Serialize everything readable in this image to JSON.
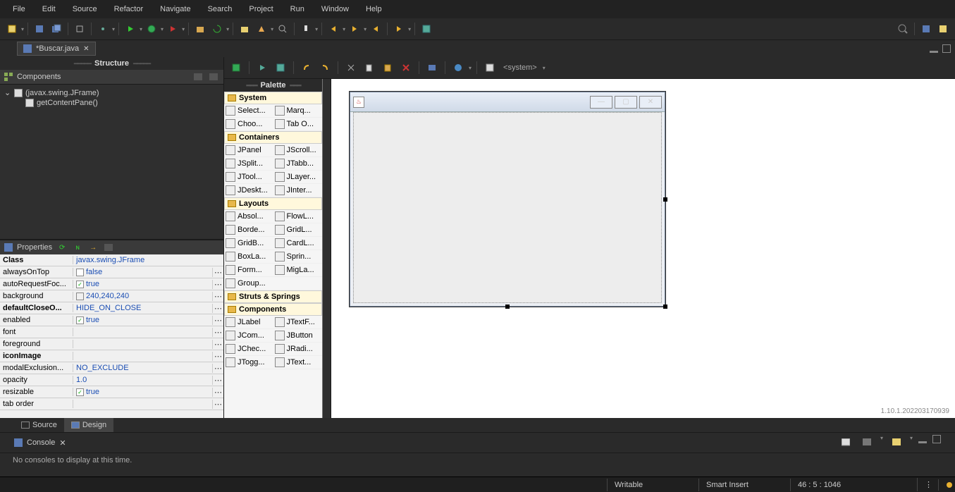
{
  "menu": [
    "File",
    "Edit",
    "Source",
    "Refactor",
    "Navigate",
    "Search",
    "Project",
    "Run",
    "Window",
    "Help"
  ],
  "file_tab": {
    "label": "*Buscar.java"
  },
  "structure": {
    "panel_label": "Structure",
    "header": "Components",
    "root": "(javax.swing.JFrame)",
    "child": "getContentPane()"
  },
  "properties": {
    "panel_label": "Properties",
    "rows": [
      {
        "k": "Class",
        "v": "javax.swing.JFrame",
        "bold": true,
        "dots": false
      },
      {
        "k": "alwaysOnTop",
        "v": "false",
        "chk": true,
        "checked": false,
        "dots": true
      },
      {
        "k": "autoRequestFoc...",
        "v": "true",
        "chk": true,
        "checked": true,
        "dots": true
      },
      {
        "k": "background",
        "v": "240,240,240",
        "swatch": "#f0f0f0",
        "dots": true
      },
      {
        "k": "defaultCloseO...",
        "v": "HIDE_ON_CLOSE",
        "bold": true,
        "dots": true
      },
      {
        "k": "enabled",
        "v": "true",
        "chk": true,
        "checked": true,
        "dots": true
      },
      {
        "k": "font",
        "v": "",
        "dots": true
      },
      {
        "k": "foreground",
        "v": "",
        "dots": true
      },
      {
        "k": "iconImage",
        "v": "",
        "bold": true,
        "dots": true
      },
      {
        "k": "modalExclusion...",
        "v": "NO_EXCLUDE",
        "dots": true
      },
      {
        "k": "opacity",
        "v": "1.0",
        "dots": true
      },
      {
        "k": "resizable",
        "v": "true",
        "chk": true,
        "checked": true,
        "dots": true
      },
      {
        "k": "tab order",
        "v": "",
        "dots": true
      }
    ]
  },
  "palette": {
    "panel_label": "Palette",
    "groups": [
      {
        "name": "System",
        "items": [
          [
            "Select...",
            "arrow"
          ],
          [
            "Marq...",
            "marquee"
          ],
          [
            "Choo...",
            "choose"
          ],
          [
            "Tab O...",
            "tab"
          ]
        ]
      },
      {
        "name": "Containers",
        "items": [
          [
            "JPanel",
            "panel"
          ],
          [
            "JScroll...",
            "scroll"
          ],
          [
            "JSplit...",
            "split"
          ],
          [
            "JTabb...",
            "tab"
          ],
          [
            "JTool...",
            "tool"
          ],
          [
            "JLayer...",
            "layer"
          ],
          [
            "JDeskt...",
            "desk"
          ],
          [
            "JInter...",
            "inter"
          ]
        ]
      },
      {
        "name": "Layouts",
        "items": [
          [
            "Absol...",
            "abs"
          ],
          [
            "FlowL...",
            "flow"
          ],
          [
            "Borde...",
            "border"
          ],
          [
            "GridL...",
            "grid"
          ],
          [
            "GridB...",
            "gridb"
          ],
          [
            "CardL...",
            "card"
          ],
          [
            "BoxLa...",
            "box"
          ],
          [
            "Sprin...",
            "spring"
          ],
          [
            "Form...",
            "form"
          ],
          [
            "MigLa...",
            "mig"
          ],
          [
            "Group...",
            "group",
            "full"
          ]
        ]
      },
      {
        "name": "Struts & Springs",
        "items": []
      },
      {
        "name": "Components",
        "items": [
          [
            "JLabel",
            "label"
          ],
          [
            "JTextF...",
            "text"
          ],
          [
            "JCom...",
            "combo"
          ],
          [
            "JButton",
            "button"
          ],
          [
            "JChec...",
            "check"
          ],
          [
            "JRadi...",
            "radio"
          ],
          [
            "JTogg...",
            "toggle"
          ],
          [
            "JText...",
            "textarea"
          ]
        ]
      }
    ]
  },
  "design_toolbar_system": "<system>",
  "bottom_tabs": {
    "source": "Source",
    "design": "Design"
  },
  "console": {
    "label": "Console",
    "msg": "No consoles to display at this time."
  },
  "version": "1.10.1.202203170939",
  "status": {
    "writable": "Writable",
    "insert": "Smart Insert",
    "pos": "46 : 5 : 1046"
  }
}
